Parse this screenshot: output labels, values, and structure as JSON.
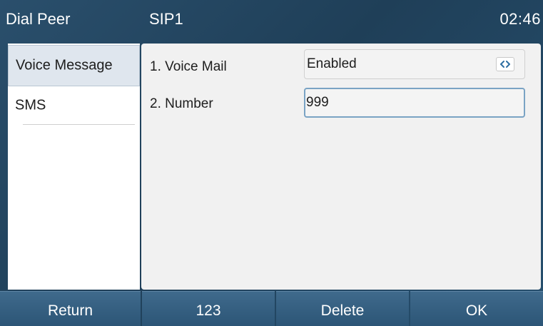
{
  "titlebar": {
    "left": "Dial Peer",
    "account": "SIP1",
    "time": "02:46"
  },
  "sidebar": {
    "items": [
      {
        "label": "Voice Message",
        "selected": true
      },
      {
        "label": "SMS",
        "selected": false
      }
    ]
  },
  "form": {
    "voice_mail": {
      "label": "1. Voice Mail",
      "value": "Enabled",
      "icon": "left-right-switch-icon"
    },
    "number": {
      "label": "2. Number",
      "value": "999"
    }
  },
  "softkeys": {
    "return": "Return",
    "mode": "123",
    "delete": "Delete",
    "ok": "OK"
  },
  "colors": {
    "background": "#244863",
    "panel": "#f1f1f1",
    "selected_item": "#dfe6ee",
    "input_focus_border": "#7aa3c4",
    "softkey": "#35607f",
    "text_light": "#ffffff",
    "text_dark": "#1d1d1d"
  }
}
